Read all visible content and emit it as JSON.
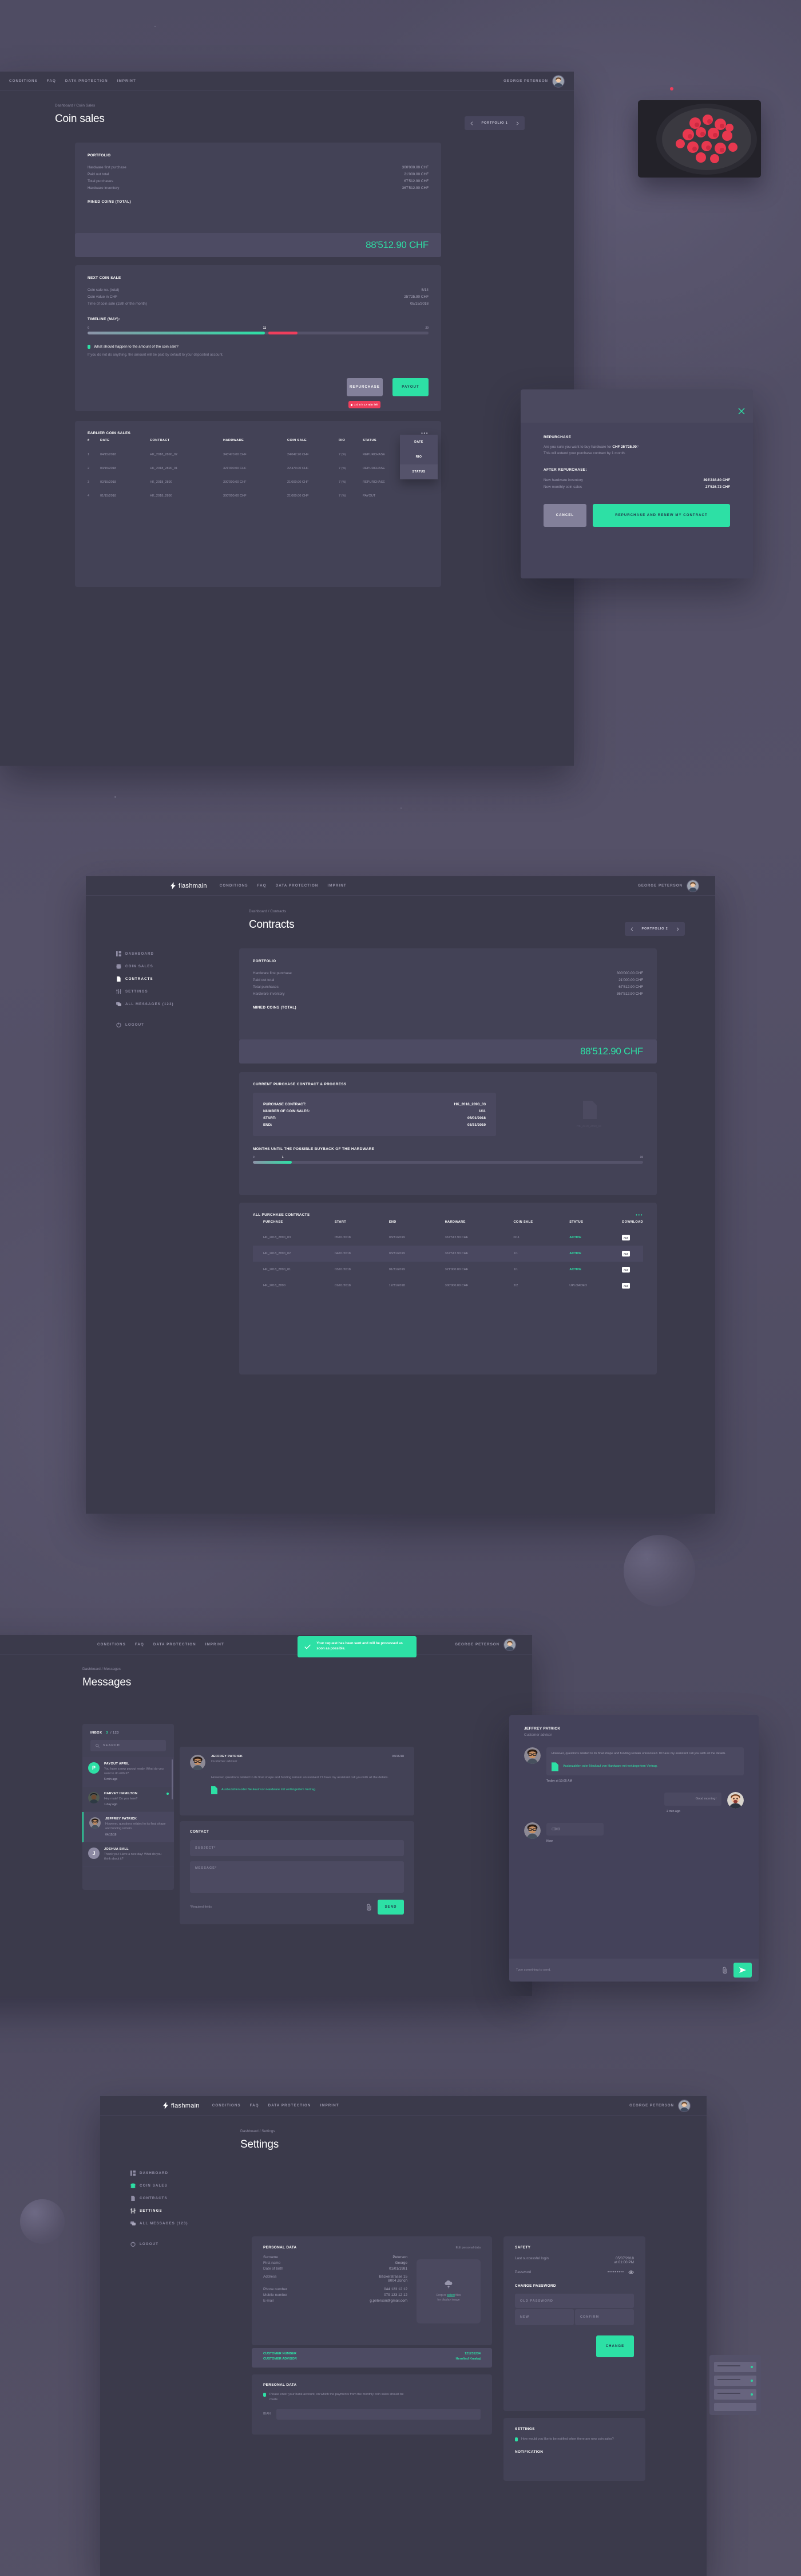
{
  "brand": {
    "name": "flashmain",
    "logo_icon": "lightning-bolt-icon"
  },
  "colors": {
    "accent": "#2de0a5",
    "danger": "#ef3e5c",
    "panel": "#3b3a4b",
    "card": "#434256"
  },
  "nav": {
    "items": [
      "CONDITIONS",
      "FAQ",
      "DATA PROTECTION",
      "IMPRINT"
    ]
  },
  "user": {
    "name": "GEORGE PETERSON"
  },
  "sidebar": {
    "items": [
      {
        "label": "DASHBOARD",
        "icon": "dashboard-icon"
      },
      {
        "label": "COIN SALES",
        "icon": "coins-icon"
      },
      {
        "label": "CONTRACTS",
        "icon": "document-icon"
      },
      {
        "label": "SETTINGS",
        "icon": "sliders-icon"
      },
      {
        "label": "ALL MESSAGES (123)",
        "icon": "chat-icon"
      }
    ],
    "logout": {
      "label": "LOGOUT",
      "icon": "power-icon"
    }
  },
  "coin_sales": {
    "breadcrumb": "Dashboard / Coiin Sales",
    "title": "Coin sales",
    "portfolio_selector": "PORTFOLIO 1",
    "portfolio": {
      "heading": "PORTFOLIO",
      "rows": [
        {
          "label": "Hardware first purchase",
          "value": "300'000.00 CHF"
        },
        {
          "label": "Paid out total",
          "value": "21'000.00 CHF"
        },
        {
          "label": "Total purchases",
          "value": "67'512.90 CHF"
        },
        {
          "label": "Hardware inventory",
          "value": "367'512.90 CHF"
        }
      ],
      "mined_label": "MINED COINS (TOTAL)",
      "mined_value": "88'512.90 CHF"
    },
    "next_sale": {
      "heading": "NEXT COIN SALE",
      "rows": [
        {
          "label": "Coin sale no. (total)",
          "value": "5/14"
        },
        {
          "label": "Coin value in CHF",
          "value": "25'725.90 CHF"
        },
        {
          "label": "Time of coin sale (15th of the month)",
          "value": "05/15/2018"
        }
      ],
      "timeline_label": "TIMELINE (MAY):",
      "timeline_min": "0",
      "timeline_cur": "11",
      "timeline_max": "20",
      "question": "What should happen to the amount of the coin sale?",
      "hint": "If you do not do anything, the amount will be paid by default to your deposited account.",
      "repurchase_label": "REPURCHASE",
      "payout_label": "PAYOUT",
      "countdown": "1 d 5 h 17 min left"
    },
    "earlier": {
      "heading": "EARLIER COIN SALES",
      "menu": [
        "DATE",
        "RIO",
        "STATUS"
      ],
      "columns": [
        "#",
        "DATE",
        "CONTRACT",
        "HARDWARE",
        "COIN SALE",
        "RIO",
        "STATUS"
      ],
      "rows": [
        [
          "1",
          "04/15/2018",
          "HK_2018_2890_02",
          "343'470.00 CHF",
          "24'042.90 CHF",
          "7 (%)",
          "REPURCHASE"
        ],
        [
          "2",
          "03/15/2018",
          "HK_2018_2890_01",
          "321'000.00 CHF",
          "22'470.00 CHF",
          "7 (%)",
          "REPURCHASE"
        ],
        [
          "3",
          "02/15/2018",
          "HK_2018_2890",
          "300'000.00 CHF",
          "21'000.00 CHF",
          "7 (%)",
          "REPURCHASE"
        ],
        [
          "4",
          "01/15/2018",
          "HK_2018_2890",
          "300'000.00 CHF",
          "21'000.00 CHF",
          "7 (%)",
          "PAYOUT"
        ]
      ]
    }
  },
  "modal": {
    "close_icon": "close-icon",
    "heading": "REPURCHASE",
    "body_prefix": "Are you sure you want to buy hardware for ",
    "body_amount": "CHF 25'725.90",
    "body_suffix": "?",
    "body_line2": "This will extend your purchase contract by 1 month.",
    "after_heading": "AFTER REPURCHASE:",
    "rows": [
      {
        "label": "New hardware inventory",
        "value": "393'238.80 CHF"
      },
      {
        "label": "New monthly coin sales",
        "value": "27'526.72 CHF"
      }
    ],
    "cancel_label": "CANCEL",
    "confirm_label": "REPURCHASE AND RENEW MY CONTRACT"
  },
  "contracts": {
    "breadcrumb": "Dashboard / Contracts",
    "title": "Contracts",
    "portfolio_selector": "PORTFOLIO 2",
    "portfolio": {
      "heading": "PORTFOLIO",
      "rows": [
        {
          "label": "Hardware first purchase",
          "value": "300'000.00 CHF"
        },
        {
          "label": "Paid out total",
          "value": "21'000.00 CHF"
        },
        {
          "label": "Total purchases",
          "value": "67'512.90 CHF"
        },
        {
          "label": "Hardware inventory",
          "value": "367'512.90 CHF"
        }
      ],
      "mined_label": "MINED COINS (TOTAL)",
      "mined_value": "88'512.90 CHF"
    },
    "current": {
      "heading": "CURRENT PURCHASE CONTRACT & PROGRESS",
      "rows": [
        {
          "label": "PURCHASE CONTRACT:",
          "value": "HK_2018_2890_03"
        },
        {
          "label": "NUMBER OF COIN SALES:",
          "value": "1/11"
        },
        {
          "label": "START:",
          "value": "05/01/2018"
        },
        {
          "label": "END:",
          "value": "03/31/2019"
        }
      ],
      "doc_caption": "HK_2018_2890_03",
      "progress_label": "MONTHS UNTIL THE POSSIBLE BUYBACK OF THE HARDWARE",
      "progress_min": "0",
      "progress_cur": "1",
      "progress_max": "10"
    },
    "all": {
      "heading": "ALL PURCHASE CONTRACTS",
      "columns": [
        "PURCHASE",
        "START",
        "END",
        "HARDWARE",
        "COIN SALE",
        "STATUS",
        "DOWNLOAD"
      ],
      "rows": [
        [
          "HK_2018_2890_03",
          "05/01/2018",
          "03/31/2019",
          "367'512.90 CHF",
          "0/11",
          "ACTIVE",
          "PDF"
        ],
        [
          "HK_2018_2890_02",
          "04/01/2018",
          "03/31/2019",
          "367'512.90 CHF",
          "1/1",
          "ACTIVE",
          "PDF"
        ],
        [
          "HK_2018_2890_01",
          "03/01/2018",
          "01/31/2019",
          "321'000.00 CHF",
          "1/1",
          "ACTIVE",
          "PDF"
        ],
        [
          "HK_2018_2890",
          "01/01/2018",
          "12/31/2018",
          "300'000.00 CHF",
          "2/2",
          "UPLOADED",
          "PDF"
        ]
      ]
    }
  },
  "messages": {
    "breadcrumb": "Dashboard / Messages",
    "title": "Messages",
    "inbox_label": "INBOX",
    "inbox_unread": "3",
    "inbox_total": "/ 123",
    "search_placeholder": "SEARCH",
    "list": [
      {
        "name": "PAYOUT APRIL",
        "text": "You have a new payout ready. What do you want to do with it?",
        "time": "5 min ago",
        "avatar": "P",
        "unread": false
      },
      {
        "name": "HARVEY HAMILTON",
        "text": "Hey mate! Do you here?",
        "time": "1 day ago",
        "avatar": "photo",
        "unread": true
      },
      {
        "name": "JEFFREY PATRICK",
        "text": "However, questions related to its final shape and funding remain",
        "time": "04/15/18",
        "avatar": "photo",
        "unread": false
      },
      {
        "name": "JOSHUA BALL",
        "text": "Thank you! Have a nice day! What do you think about it?",
        "time": "",
        "avatar": "J",
        "unread": false
      }
    ],
    "toast": "Your request has been sent and will be processed as soon as possible.",
    "detail": {
      "name": "JEFFREY PATRICK",
      "role": "Customer advisor",
      "date": "04/15/18",
      "body": "However, questions related to its final shape and funding remain unresolved. I'll have my assistant call you with all the details.",
      "attachment": "Ausbezahlen oder Neukauf von Hardware mit verlängertem Vertrag.",
      "attachment_type": "PDF"
    },
    "contact": {
      "heading": "CONTACT",
      "subject_placeholder": "SUBJECT*",
      "message_placeholder": "MESSAGE*",
      "required_note": "*Required fields",
      "attach_icon": "paperclip-icon",
      "send_label": "SEND"
    },
    "chat": {
      "name": "JEFFREY PATRICK",
      "role": "Customer advisor",
      "messages": [
        {
          "side": "in",
          "text": "However, questions related to its final shape and funding remain unresolved. I'll have my assistant call you with all the details.",
          "attachment": "Ausbezahlen oder Neukauf von Hardware mit verlängertem Vertrag.",
          "time": "Today at 10:05 AM"
        },
        {
          "side": "out",
          "text": "Good morning!",
          "time": "2 min ago"
        },
        {
          "side": "in",
          "text": ":)))))))",
          "time": "Now"
        }
      ],
      "input_placeholder": "Type something to send.",
      "send_icon": "send-icon"
    }
  },
  "settings": {
    "breadcrumb": "Dashboard / Settings",
    "title": "Settings",
    "personal": {
      "heading": "PERSONAL DATA",
      "edit_link": "Edit personal data",
      "rows": [
        {
          "label": "Surname",
          "value": "Peterson"
        },
        {
          "label": "First name",
          "value": "George"
        },
        {
          "label": "Date of birth",
          "value": "01/01/1981"
        },
        {
          "label": "Address",
          "value": "Bäckerstrasse 15\n8004 Zürich"
        },
        {
          "label": "Phone number",
          "value": "044 123 12 12"
        },
        {
          "label": "Mobile number",
          "value": "079 123 12 12"
        },
        {
          "label": "E-mail",
          "value": "g.peterson@gmail.com"
        }
      ],
      "dropzone_prefix": "Drop or ",
      "dropzone_link": "select",
      "dropzone_suffix": " files",
      "dropzone_line2": "for display image",
      "customer_number_label": "CUSTOMER NUMBER",
      "customer_number_value": "121231234",
      "customer_advisor_label": "CUSTOMER ADVISOR",
      "customer_advisor_value": "Herolind Krrakaj"
    },
    "personal_note": {
      "heading": "PERSONAL DATA",
      "text": "Please enter your bank account, on which the payments from the monthly coin sales should be made.",
      "field_label": "IBAN"
    },
    "safety": {
      "heading": "SAFETY",
      "last_login_label": "Last successful login",
      "last_login_value": "05/07/2018\nat 01:00 PM",
      "password_label": "Password",
      "password_mask": "•••••••••",
      "eye_icon": "eye-icon",
      "change_heading": "CHANGE PASSWORD",
      "old_placeholder": "OLD PASSWORD",
      "new_placeholder": "NEW",
      "confirm_placeholder": "CONFIRM",
      "change_label": "CHANGE"
    },
    "notify": {
      "heading": "SETTINGS",
      "question": "How would you like to be notified when there are new coin sales?",
      "sub_heading": "NOTIFICATION"
    }
  }
}
